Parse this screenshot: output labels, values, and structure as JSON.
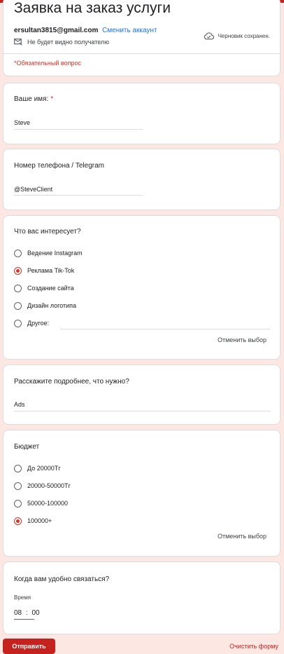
{
  "header": {
    "title": "Заявка на заказ услуги",
    "account_email": "ersultan3815@gmail.com",
    "switch_account": "Сменить аккаунт",
    "not_visible": "Не будет видно получателю",
    "draft_saved": "Черновик сохранен.",
    "required_note": "*Обязательный вопрос"
  },
  "q_name": {
    "title": "Ваше имя:",
    "required_mark": "*",
    "answer": "Steve"
  },
  "q_phone": {
    "title": "Номер телефона / Telegram",
    "answer": "@SteveClient"
  },
  "q_interest": {
    "title": "Что вас интересует?",
    "options": [
      {
        "label": "Ведение Instagram",
        "checked": false
      },
      {
        "label": "Реклама Tik-Tok",
        "checked": true
      },
      {
        "label": "Создание сайта",
        "checked": false
      },
      {
        "label": "Дизайн логотипа",
        "checked": false
      },
      {
        "label": "Другое:",
        "checked": false
      }
    ],
    "clear": "Отменить выбор"
  },
  "q_details": {
    "title": "Расскажите подробнее, что нужно?",
    "answer": "Ads"
  },
  "q_budget": {
    "title": "Бюджет",
    "options": [
      {
        "label": "До 20000Тг",
        "checked": false
      },
      {
        "label": "20000-50000Тг",
        "checked": false
      },
      {
        "label": "50000-100000",
        "checked": false
      },
      {
        "label": "100000+",
        "checked": true
      }
    ],
    "clear": "Отменить выбор"
  },
  "q_time": {
    "title": "Когда вам удобно связаться?",
    "time_label": "Время",
    "hours": "08",
    "separator": ":",
    "minutes": "00"
  },
  "footer": {
    "submit": "Отправить",
    "clear_form": "Очистить форму"
  },
  "colors": {
    "accent": "#c5221f",
    "required": "#d93025",
    "link": "#1a73e8",
    "background": "#fce7e3"
  },
  "icons": {
    "private": "envelope-hidden-icon",
    "draft": "cloud-check-icon"
  }
}
